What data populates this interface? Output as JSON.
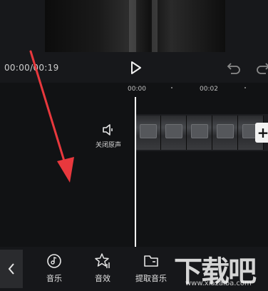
{
  "player": {
    "time_display": "00:00/00:19"
  },
  "timeline": {
    "ruler_labels": [
      "00:00",
      "00:02"
    ]
  },
  "audio": {
    "mute_label": "关闭原声"
  },
  "clip": {
    "add_symbol": "+"
  },
  "toolbar": {
    "back_icon": "chevron-left-icon",
    "tools": [
      {
        "label": "音乐",
        "icon": "music-disc-icon"
      },
      {
        "label": "音效",
        "icon": "star-sound-icon"
      },
      {
        "label": "提取音乐",
        "icon": "folder-extract-icon"
      }
    ]
  },
  "watermark": {
    "logo": "下载吧",
    "url": "www.xiazaiba.com"
  },
  "colors": {
    "background": "#111214",
    "annotation_arrow": "#e8383d",
    "playhead": "#ffffff"
  }
}
